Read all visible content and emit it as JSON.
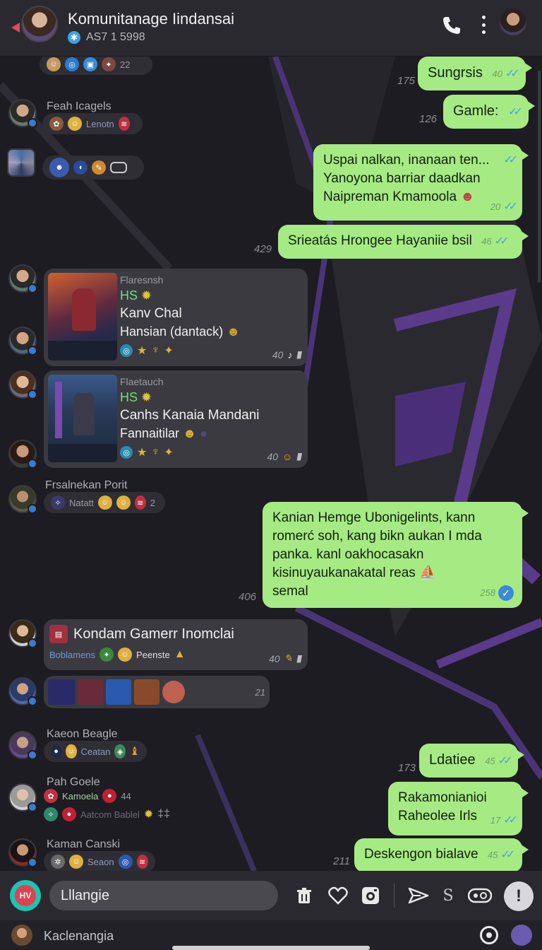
{
  "header": {
    "title": "Komunitanage Iindansai",
    "subtitle": "AS7 1 5998",
    "subtitle_badge": "✱"
  },
  "messages": {
    "top_reactions": {
      "count": "22"
    },
    "out1": {
      "text": "Sungrsis",
      "time": "40",
      "side": "175"
    },
    "in_fean": {
      "name": "Feah Icagels",
      "reaction_text": "Lenotn"
    },
    "out2": {
      "text": "Gamle:",
      "side": "126"
    },
    "out3": {
      "line1": "Uspai nalkan, inanaan ten...",
      "line2": "Yanoyona barriar daadkan",
      "line3": "Naipreman Kmamoola",
      "time": "20"
    },
    "out4": {
      "text": "Srieatás Hrongee Hayaniie bsil",
      "time": "46",
      "side": "429"
    },
    "card1": {
      "source": "Flaresnsh",
      "tag": "HS",
      "line1": "Kanv Chal",
      "line2": "Hansian (dantack)",
      "time": "40"
    },
    "card2": {
      "source": "Flaetauch",
      "tag": "HS",
      "line1": "Canhs Kanaia Mandani",
      "line2": "Fannaitilar",
      "time": "40"
    },
    "in_fsa": {
      "name": "Frsalnekan Porit",
      "reaction_text": "Natatt",
      "count": "2"
    },
    "out5": {
      "line1": "Kanian Hemge Ubonigelints, kann",
      "line2": "romerć soh, kang bikn aukan I mda",
      "line3": "panka. kanl oakhocasakn",
      "line4": "kisinuyaukanakatal reas",
      "line5": "semal",
      "time": "258",
      "side": "406"
    },
    "card3": {
      "title": "Kondam Gamerr Inomclai",
      "reaction_text": "Boblamens",
      "reaction_text2": "Peenste",
      "time": "40"
    },
    "media_row": {
      "count": "21"
    },
    "in_kaon": {
      "name": "Kaeon Beagle",
      "reaction_text": "Ceatan"
    },
    "out6": {
      "text": "Ldatiee",
      "time": "45",
      "side": "173"
    },
    "in_pah": {
      "name": "Pah Goele",
      "reaction_text": "Kamoela",
      "reaction_text2": "Aatcom Bablel",
      "count": "44"
    },
    "out7": {
      "line1": "Rakamonianioi",
      "line2": "Raheolee Irls",
      "time": "17"
    },
    "in_kaman": {
      "name": "Kaman Canski",
      "reaction_text": "Seaon"
    },
    "out8": {
      "text": "Deskengon bialave",
      "time": "45",
      "side": "211"
    }
  },
  "input": {
    "value": "Lllangie",
    "app_icon_label": "HV"
  },
  "bottom": {
    "label": "Kaclenangia"
  },
  "colors": {
    "accent_green": "#a6ea84",
    "check_blue": "#4fa3d8",
    "header_bg": "#2a292f",
    "chat_bg": "#1d1c22",
    "card_bg": "#3a3a40",
    "purple_art": "#5a3a8a"
  },
  "icons": [
    "back-arrow-icon",
    "phone-icon",
    "more-vertical-icon",
    "trash-icon",
    "heart-icon",
    "camera-icon",
    "send-icon",
    "s-icon",
    "gamepad-icon",
    "mic-icon",
    "target-icon"
  ]
}
